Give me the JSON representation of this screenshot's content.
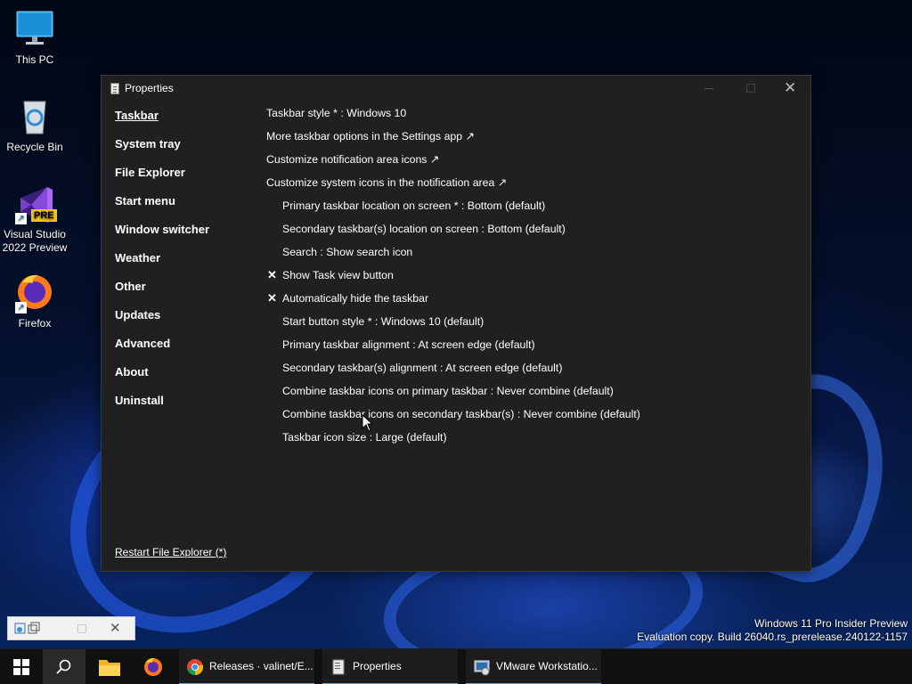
{
  "desktop": {
    "icons": [
      {
        "label": "This PC"
      },
      {
        "label": "Recycle Bin"
      },
      {
        "label_line1": "Visual Studio",
        "label_line2": "2022 Preview",
        "badge": "PRE"
      },
      {
        "label": "Firefox"
      }
    ],
    "watermark": {
      "line1": "Windows 11 Pro Insider Preview",
      "line2": "Evaluation copy. Build 26040.rs_prerelease.240122-1157"
    }
  },
  "window": {
    "title": "Properties",
    "nav": [
      {
        "label": "Taskbar",
        "active": true
      },
      {
        "label": "System tray"
      },
      {
        "label": "File Explorer"
      },
      {
        "label": "Start menu"
      },
      {
        "label": "Window switcher"
      },
      {
        "label": "Weather"
      },
      {
        "label": "Other"
      },
      {
        "label": "Updates"
      },
      {
        "label": "Advanced"
      },
      {
        "label": "About"
      },
      {
        "label": "Uninstall"
      }
    ],
    "settings": [
      {
        "label": "Taskbar style * : Windows 10"
      },
      {
        "label": "More taskbar options in the Settings app ↗"
      },
      {
        "label": "Customize notification area icons ↗"
      },
      {
        "label": "Customize system icons in the notification area ↗"
      },
      {
        "label": "Primary taskbar location on screen * : Bottom (default)"
      },
      {
        "label": "Secondary taskbar(s) location on screen : Bottom (default)"
      },
      {
        "label": "Search : Show search icon"
      },
      {
        "label": "Show Task view button",
        "checked": true
      },
      {
        "label": "Automatically hide the taskbar",
        "checked": true
      },
      {
        "label": "Start button style * : Windows 10 (default)"
      },
      {
        "label": "Primary taskbar alignment : At screen edge (default)"
      },
      {
        "label": "Secondary taskbar(s) alignment : At screen edge (default)"
      },
      {
        "label": "Combine taskbar icons on primary taskbar : Never combine (default)"
      },
      {
        "label": "Combine taskbar icons on secondary taskbar(s) : Never combine (default)"
      },
      {
        "label": "Taskbar icon size : Large (default)"
      }
    ],
    "restart_link": "Restart File Explorer (*)"
  },
  "taskbar": {
    "apps": [
      {
        "label": "Releases · valinet/E..."
      },
      {
        "label": "Properties"
      },
      {
        "label": "VMware Workstatio..."
      }
    ]
  },
  "colors": {
    "window_bg": "#202020",
    "taskbar_bg": "#101010",
    "active_underline": "#5aa7e8"
  }
}
